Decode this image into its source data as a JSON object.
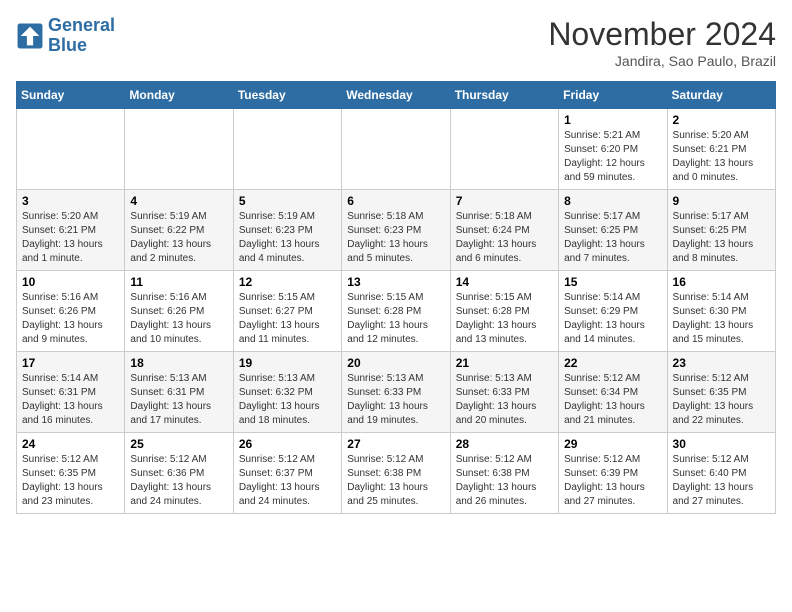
{
  "logo": {
    "line1": "General",
    "line2": "Blue"
  },
  "title": "November 2024",
  "location": "Jandira, Sao Paulo, Brazil",
  "weekdays": [
    "Sunday",
    "Monday",
    "Tuesday",
    "Wednesday",
    "Thursday",
    "Friday",
    "Saturday"
  ],
  "weeks": [
    [
      {
        "day": "",
        "info": ""
      },
      {
        "day": "",
        "info": ""
      },
      {
        "day": "",
        "info": ""
      },
      {
        "day": "",
        "info": ""
      },
      {
        "day": "",
        "info": ""
      },
      {
        "day": "1",
        "info": "Sunrise: 5:21 AM\nSunset: 6:20 PM\nDaylight: 12 hours and 59 minutes."
      },
      {
        "day": "2",
        "info": "Sunrise: 5:20 AM\nSunset: 6:21 PM\nDaylight: 13 hours and 0 minutes."
      }
    ],
    [
      {
        "day": "3",
        "info": "Sunrise: 5:20 AM\nSunset: 6:21 PM\nDaylight: 13 hours and 1 minute."
      },
      {
        "day": "4",
        "info": "Sunrise: 5:19 AM\nSunset: 6:22 PM\nDaylight: 13 hours and 2 minutes."
      },
      {
        "day": "5",
        "info": "Sunrise: 5:19 AM\nSunset: 6:23 PM\nDaylight: 13 hours and 4 minutes."
      },
      {
        "day": "6",
        "info": "Sunrise: 5:18 AM\nSunset: 6:23 PM\nDaylight: 13 hours and 5 minutes."
      },
      {
        "day": "7",
        "info": "Sunrise: 5:18 AM\nSunset: 6:24 PM\nDaylight: 13 hours and 6 minutes."
      },
      {
        "day": "8",
        "info": "Sunrise: 5:17 AM\nSunset: 6:25 PM\nDaylight: 13 hours and 7 minutes."
      },
      {
        "day": "9",
        "info": "Sunrise: 5:17 AM\nSunset: 6:25 PM\nDaylight: 13 hours and 8 minutes."
      }
    ],
    [
      {
        "day": "10",
        "info": "Sunrise: 5:16 AM\nSunset: 6:26 PM\nDaylight: 13 hours and 9 minutes."
      },
      {
        "day": "11",
        "info": "Sunrise: 5:16 AM\nSunset: 6:26 PM\nDaylight: 13 hours and 10 minutes."
      },
      {
        "day": "12",
        "info": "Sunrise: 5:15 AM\nSunset: 6:27 PM\nDaylight: 13 hours and 11 minutes."
      },
      {
        "day": "13",
        "info": "Sunrise: 5:15 AM\nSunset: 6:28 PM\nDaylight: 13 hours and 12 minutes."
      },
      {
        "day": "14",
        "info": "Sunrise: 5:15 AM\nSunset: 6:28 PM\nDaylight: 13 hours and 13 minutes."
      },
      {
        "day": "15",
        "info": "Sunrise: 5:14 AM\nSunset: 6:29 PM\nDaylight: 13 hours and 14 minutes."
      },
      {
        "day": "16",
        "info": "Sunrise: 5:14 AM\nSunset: 6:30 PM\nDaylight: 13 hours and 15 minutes."
      }
    ],
    [
      {
        "day": "17",
        "info": "Sunrise: 5:14 AM\nSunset: 6:31 PM\nDaylight: 13 hours and 16 minutes."
      },
      {
        "day": "18",
        "info": "Sunrise: 5:13 AM\nSunset: 6:31 PM\nDaylight: 13 hours and 17 minutes."
      },
      {
        "day": "19",
        "info": "Sunrise: 5:13 AM\nSunset: 6:32 PM\nDaylight: 13 hours and 18 minutes."
      },
      {
        "day": "20",
        "info": "Sunrise: 5:13 AM\nSunset: 6:33 PM\nDaylight: 13 hours and 19 minutes."
      },
      {
        "day": "21",
        "info": "Sunrise: 5:13 AM\nSunset: 6:33 PM\nDaylight: 13 hours and 20 minutes."
      },
      {
        "day": "22",
        "info": "Sunrise: 5:12 AM\nSunset: 6:34 PM\nDaylight: 13 hours and 21 minutes."
      },
      {
        "day": "23",
        "info": "Sunrise: 5:12 AM\nSunset: 6:35 PM\nDaylight: 13 hours and 22 minutes."
      }
    ],
    [
      {
        "day": "24",
        "info": "Sunrise: 5:12 AM\nSunset: 6:35 PM\nDaylight: 13 hours and 23 minutes."
      },
      {
        "day": "25",
        "info": "Sunrise: 5:12 AM\nSunset: 6:36 PM\nDaylight: 13 hours and 24 minutes."
      },
      {
        "day": "26",
        "info": "Sunrise: 5:12 AM\nSunset: 6:37 PM\nDaylight: 13 hours and 24 minutes."
      },
      {
        "day": "27",
        "info": "Sunrise: 5:12 AM\nSunset: 6:38 PM\nDaylight: 13 hours and 25 minutes."
      },
      {
        "day": "28",
        "info": "Sunrise: 5:12 AM\nSunset: 6:38 PM\nDaylight: 13 hours and 26 minutes."
      },
      {
        "day": "29",
        "info": "Sunrise: 5:12 AM\nSunset: 6:39 PM\nDaylight: 13 hours and 27 minutes."
      },
      {
        "day": "30",
        "info": "Sunrise: 5:12 AM\nSunset: 6:40 PM\nDaylight: 13 hours and 27 minutes."
      }
    ]
  ]
}
